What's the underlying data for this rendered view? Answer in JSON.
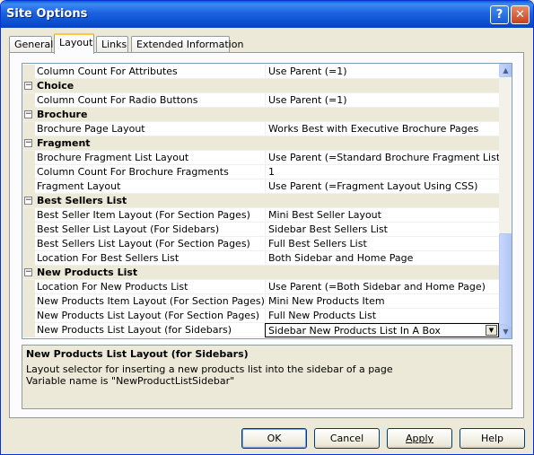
{
  "window": {
    "title": "Site Options",
    "help_symbol": "?",
    "close_symbol": "✕"
  },
  "tabs": [
    "General",
    "Layout",
    "Links",
    "Extended Information"
  ],
  "active_tab": "Layout",
  "rows": [
    {
      "type": "prop",
      "name": "Column Count For Attributes",
      "value": "Use Parent (=1)"
    },
    {
      "type": "cat",
      "name": "Choice"
    },
    {
      "type": "prop",
      "name": "Column Count For Radio Buttons",
      "value": "Use Parent (=1)"
    },
    {
      "type": "cat",
      "name": "Brochure"
    },
    {
      "type": "prop",
      "name": "Brochure Page Layout",
      "value": "Works Best with Executive Brochure Pages"
    },
    {
      "type": "cat",
      "name": "Fragment"
    },
    {
      "type": "prop",
      "name": "Brochure Fragment List Layout",
      "value": "Use Parent (=Standard Brochure Fragment List)"
    },
    {
      "type": "prop",
      "name": "Column Count For Brochure Fragments",
      "value": "1"
    },
    {
      "type": "prop",
      "name": "Fragment Layout",
      "value": "Use Parent (=Fragment Layout Using CSS)"
    },
    {
      "type": "cat",
      "name": "Best Sellers List"
    },
    {
      "type": "prop",
      "name": "Best Seller Item Layout (For Section Pages)",
      "value": "Mini Best Seller Layout"
    },
    {
      "type": "prop",
      "name": "Best Seller List Layout (For Sidebars)",
      "value": "Sidebar Best Sellers List"
    },
    {
      "type": "prop",
      "name": "Best Sellers List Layout (For Section Pages)",
      "value": "Full Best Sellers List"
    },
    {
      "type": "prop",
      "name": "Location For Best Sellers List",
      "value": "Both Sidebar and Home Page"
    },
    {
      "type": "cat",
      "name": "New Products List"
    },
    {
      "type": "prop",
      "name": "Location For New Products List",
      "value": "Use Parent (=Both Sidebar and Home Page)"
    },
    {
      "type": "prop",
      "name": "New Products Item Layout (For Section Pages)",
      "value": "Mini New Products Item"
    },
    {
      "type": "prop",
      "name": "New Products List Layout (For Section Pages)",
      "value": "Full New Products List"
    },
    {
      "type": "prop",
      "name": "New Products List Layout (for Sidebars)",
      "value": "Sidebar New Products List In A Box",
      "selected": true
    }
  ],
  "collapse_symbol": "−",
  "dropdown_symbol": "▼",
  "scroll_up_symbol": "▲",
  "scroll_down_symbol": "▼",
  "description": {
    "title": "New Products List Layout (for Sidebars)",
    "line1": "Layout selector for inserting a new products list into the sidebar of a page",
    "line2": "Variable name is \"NewProductListSidebar\""
  },
  "buttons": {
    "ok": "OK",
    "cancel": "Cancel",
    "apply": "Apply",
    "help": "Help"
  }
}
